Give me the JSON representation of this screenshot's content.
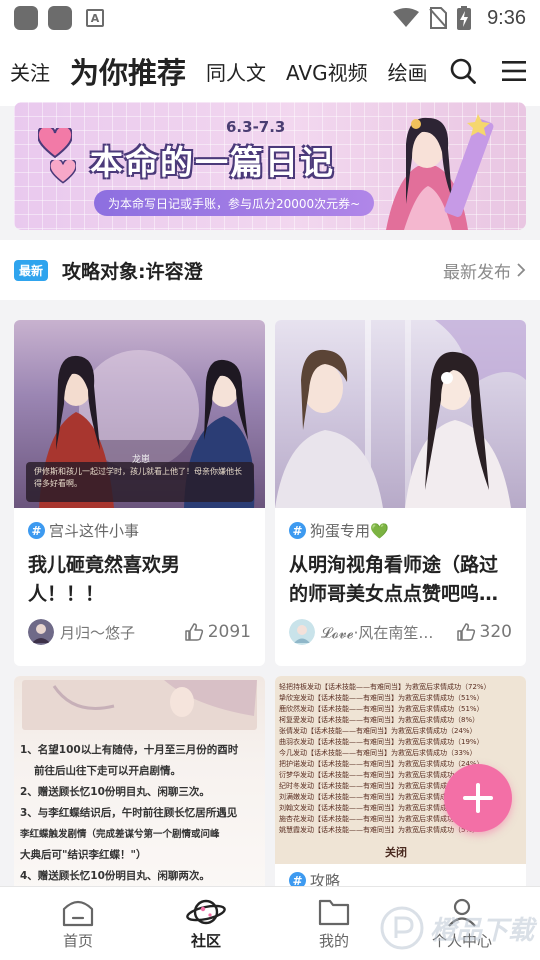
{
  "status_bar": {
    "time": "9:36",
    "a_icon_letter": "A"
  },
  "top_nav": {
    "tabs": [
      {
        "label": "关注",
        "active": false
      },
      {
        "label": "为你推荐",
        "active": true
      },
      {
        "label": "同人文",
        "active": false
      },
      {
        "label": "AVG视频",
        "active": false
      },
      {
        "label": "绘画",
        "active": false
      }
    ],
    "icons": [
      "search-icon",
      "menu-icon"
    ]
  },
  "banner": {
    "date": "6.3-7.3",
    "title": "本命的一篇日记",
    "subtitle": "为本命写日记或手账，参与瓜分20000次元券~"
  },
  "section": {
    "badge": "最新",
    "title": "攻略对象:许容澄",
    "more": "最新发布"
  },
  "cards": [
    {
      "image_caption_name": "龙崽",
      "image_caption_text": "伊修斯和孩儿一起过学时，孩儿就看上他了！母亲你嫌他长得多好看啊。",
      "tag": "宫斗这件小事",
      "title": "我儿砸竟然喜欢男人！！！",
      "author": "月归〜悠子",
      "likes": "2091"
    },
    {
      "tag": "狗蛋专用💚",
      "title": "从明洵视角看师途（路过的师哥美女点点赞吧呜…",
      "author": "𝓛𝓸𝓿𝓮·风在南笙…",
      "likes": "320"
    },
    {
      "lines": [
        "1、名望100以上有随侍，十月至三月份的酉时",
        "前往后山往下走可以开启剧情。",
        "2、赠送顾长忆10份明目丸、闲聊三次。",
        "3、与李红蝶结识后，午时前往顾长忆居所遇见",
        "李红蝶触发剧情（完成差谋兮第一个剧情或问峰",
        "大典后可\"结识李红蝶！\"）",
        "4、赠送顾长忆10份明目丸、闲聊两次。"
      ]
    },
    {
      "text_lines": [
        "轻把持板发动【话术技能——有难同当】为救宽后求情成功（72%）",
        "挚欣宠发动【话术技能——有难同当】为救宽后求情成功（51%）",
        "鹿欣然发动【话术技能——有难同当】为救宽后求情成功（51%）",
        "柯复愛发动【话术技能——有难同当】为救宽后求情成功（8%）",
        "张倩发动【话术技能——有难同当】为救宽后求情成功（24%）",
        "曲羽衣发动【话术技能——有难同当】为救宽后求情成功（19%）",
        "今几发动【话术技能——有难同当】为救宽后求情成功（33%）",
        "把护诺发动【话术技能——有难同当】为救宽后求情成功（24%）",
        "衍梦华发动【话术技能——有难同当】为救宽后求情成功（21%）",
        "纪时冬发动【话术技能——有难同当】为救宽后求情成功（15%）",
        "刘满嫩发动【话术技能——有难同当】为救宽后求情成功（12%）",
        "刘翰文发动【话术技能——有难同当】为救宽后求情成功（10%）",
        "施杏花发动【话术技能——有难同当】为救宽后求情成功（7%）",
        "姚慧霞发动【话术技能——有难同当】为救宽后求情成功（5%）"
      ],
      "image_caption": "关闭",
      "tag": "攻略"
    }
  ],
  "bottom_nav": [
    {
      "label": "首页",
      "icon": "home-icon",
      "active": false
    },
    {
      "label": "社区",
      "icon": "planet-icon",
      "active": true
    },
    {
      "label": "我的",
      "icon": "folder-icon",
      "active": false
    },
    {
      "label": "个人中心",
      "icon": "user-icon",
      "active": false
    }
  ],
  "watermark": "橙品下载",
  "colors": {
    "accent_pink": "#f36fa6",
    "tag_blue": "#3d9af0",
    "badge_blue": "#2fa4ee"
  }
}
